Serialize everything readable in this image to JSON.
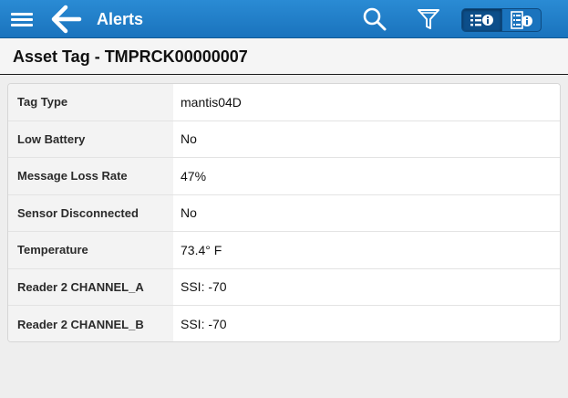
{
  "topbar": {
    "title": "Alerts",
    "icons": {
      "menu": "hamburger-menu-icon",
      "back": "arrow-left-icon",
      "search": "search-icon",
      "filter": "filter-funnel-icon",
      "list_info": "list-info-icon",
      "detail_info": "detail-info-icon"
    },
    "colors": {
      "bar": "#1a73bd",
      "icon": "#ffffff"
    }
  },
  "header": {
    "title": "Asset Tag - TMPRCK00000007"
  },
  "details": {
    "rows": [
      {
        "label": "Tag Type",
        "value": "mantis04D"
      },
      {
        "label": "Low Battery",
        "value": "No"
      },
      {
        "label": "Message Loss Rate",
        "value": "47%"
      },
      {
        "label": "Sensor Disconnected",
        "value": "No"
      },
      {
        "label": "Temperature",
        "value": "73.4° F"
      },
      {
        "label": "Reader 2 CHANNEL_A",
        "value": "SSI: -70"
      },
      {
        "label": "Reader 2 CHANNEL_B",
        "value": "SSI: -70"
      }
    ]
  }
}
